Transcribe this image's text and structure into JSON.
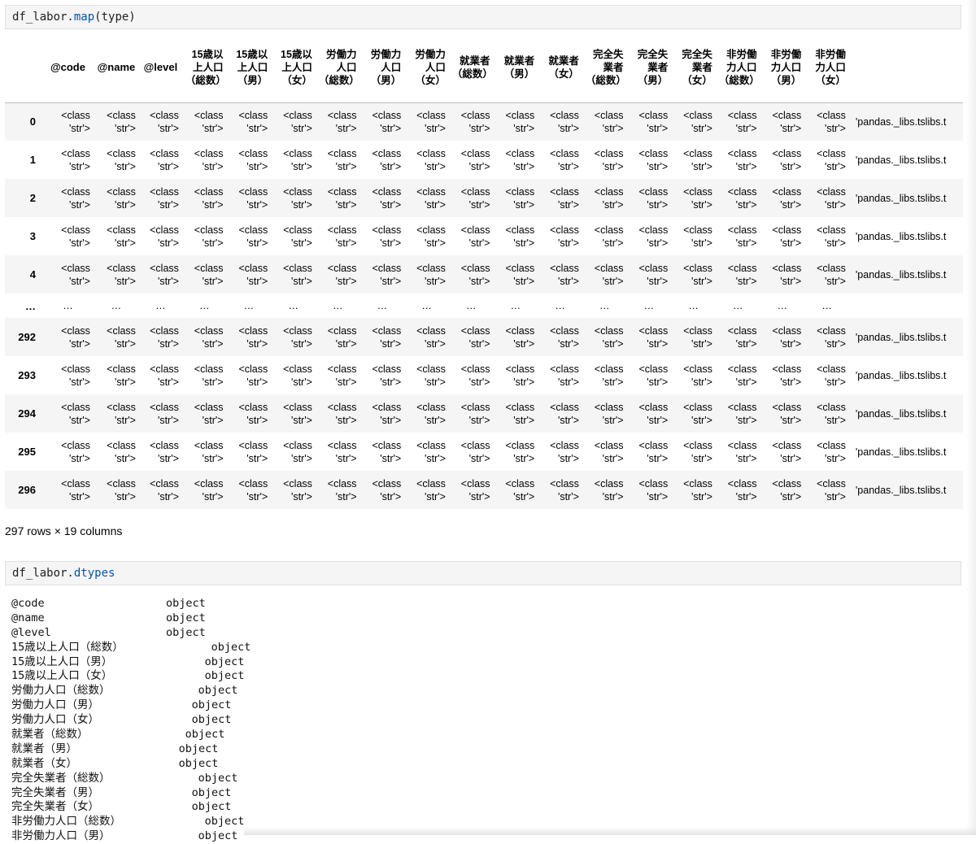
{
  "cell1": {
    "code_prefix": "df_labor.",
    "code_attr": "map",
    "code_suffix": "(type)"
  },
  "table": {
    "columns": [
      "@code",
      "@name",
      "@level",
      "15歳以上人口（総数）",
      "15歳以上人口（男）",
      "15歳以上人口（女）",
      "労働力人口（総数）",
      "労働力人口（男）",
      "労働力人口（女）",
      "就業者（総数）",
      "就業者（男）",
      "就業者（女）",
      "完全失業者（総数）",
      "完全失業者（男）",
      "完全失業者（女）",
      "非労働力人口（総数）",
      "非労働力人口（男）",
      "非労働力人口（女）"
    ],
    "index": [
      "0",
      "1",
      "2",
      "3",
      "4",
      "…",
      "292",
      "293",
      "294",
      "295",
      "296"
    ],
    "cell_value": "<class 'str'>",
    "last_col_value": "'pandas._libs.tslibs.t",
    "ellipsis": "…"
  },
  "shape_text": "297 rows × 19 columns",
  "cell2": {
    "code_prefix": "df_labor.",
    "code_attr": "dtypes"
  },
  "dtypes": [
    {
      "name": "@code",
      "dtype": "object"
    },
    {
      "name": "@name",
      "dtype": "object"
    },
    {
      "name": "@level",
      "dtype": "object"
    },
    {
      "name": "15歳以上人口（総数）",
      "dtype": "object"
    },
    {
      "name": "15歳以上人口（男）",
      "dtype": "object"
    },
    {
      "name": "15歳以上人口（女）",
      "dtype": "object"
    },
    {
      "name": "労働力人口（総数）",
      "dtype": "object"
    },
    {
      "name": "労働力人口（男）",
      "dtype": "object"
    },
    {
      "name": "労働力人口（女）",
      "dtype": "object"
    },
    {
      "name": "就業者（総数）",
      "dtype": "object"
    },
    {
      "name": "就業者（男）",
      "dtype": "object"
    },
    {
      "name": "就業者（女）",
      "dtype": "object"
    },
    {
      "name": "完全失業者（総数）",
      "dtype": "object"
    },
    {
      "name": "完全失業者（男）",
      "dtype": "object"
    },
    {
      "name": "完全失業者（女）",
      "dtype": "object"
    },
    {
      "name": "非労働力人口（総数）",
      "dtype": "object"
    },
    {
      "name": "非労働力人口（男）",
      "dtype": "object"
    }
  ],
  "colors": {
    "code_attr": "#0055aa",
    "stripe": "#f5f5f5",
    "input_bg": "#f5f5f5"
  }
}
